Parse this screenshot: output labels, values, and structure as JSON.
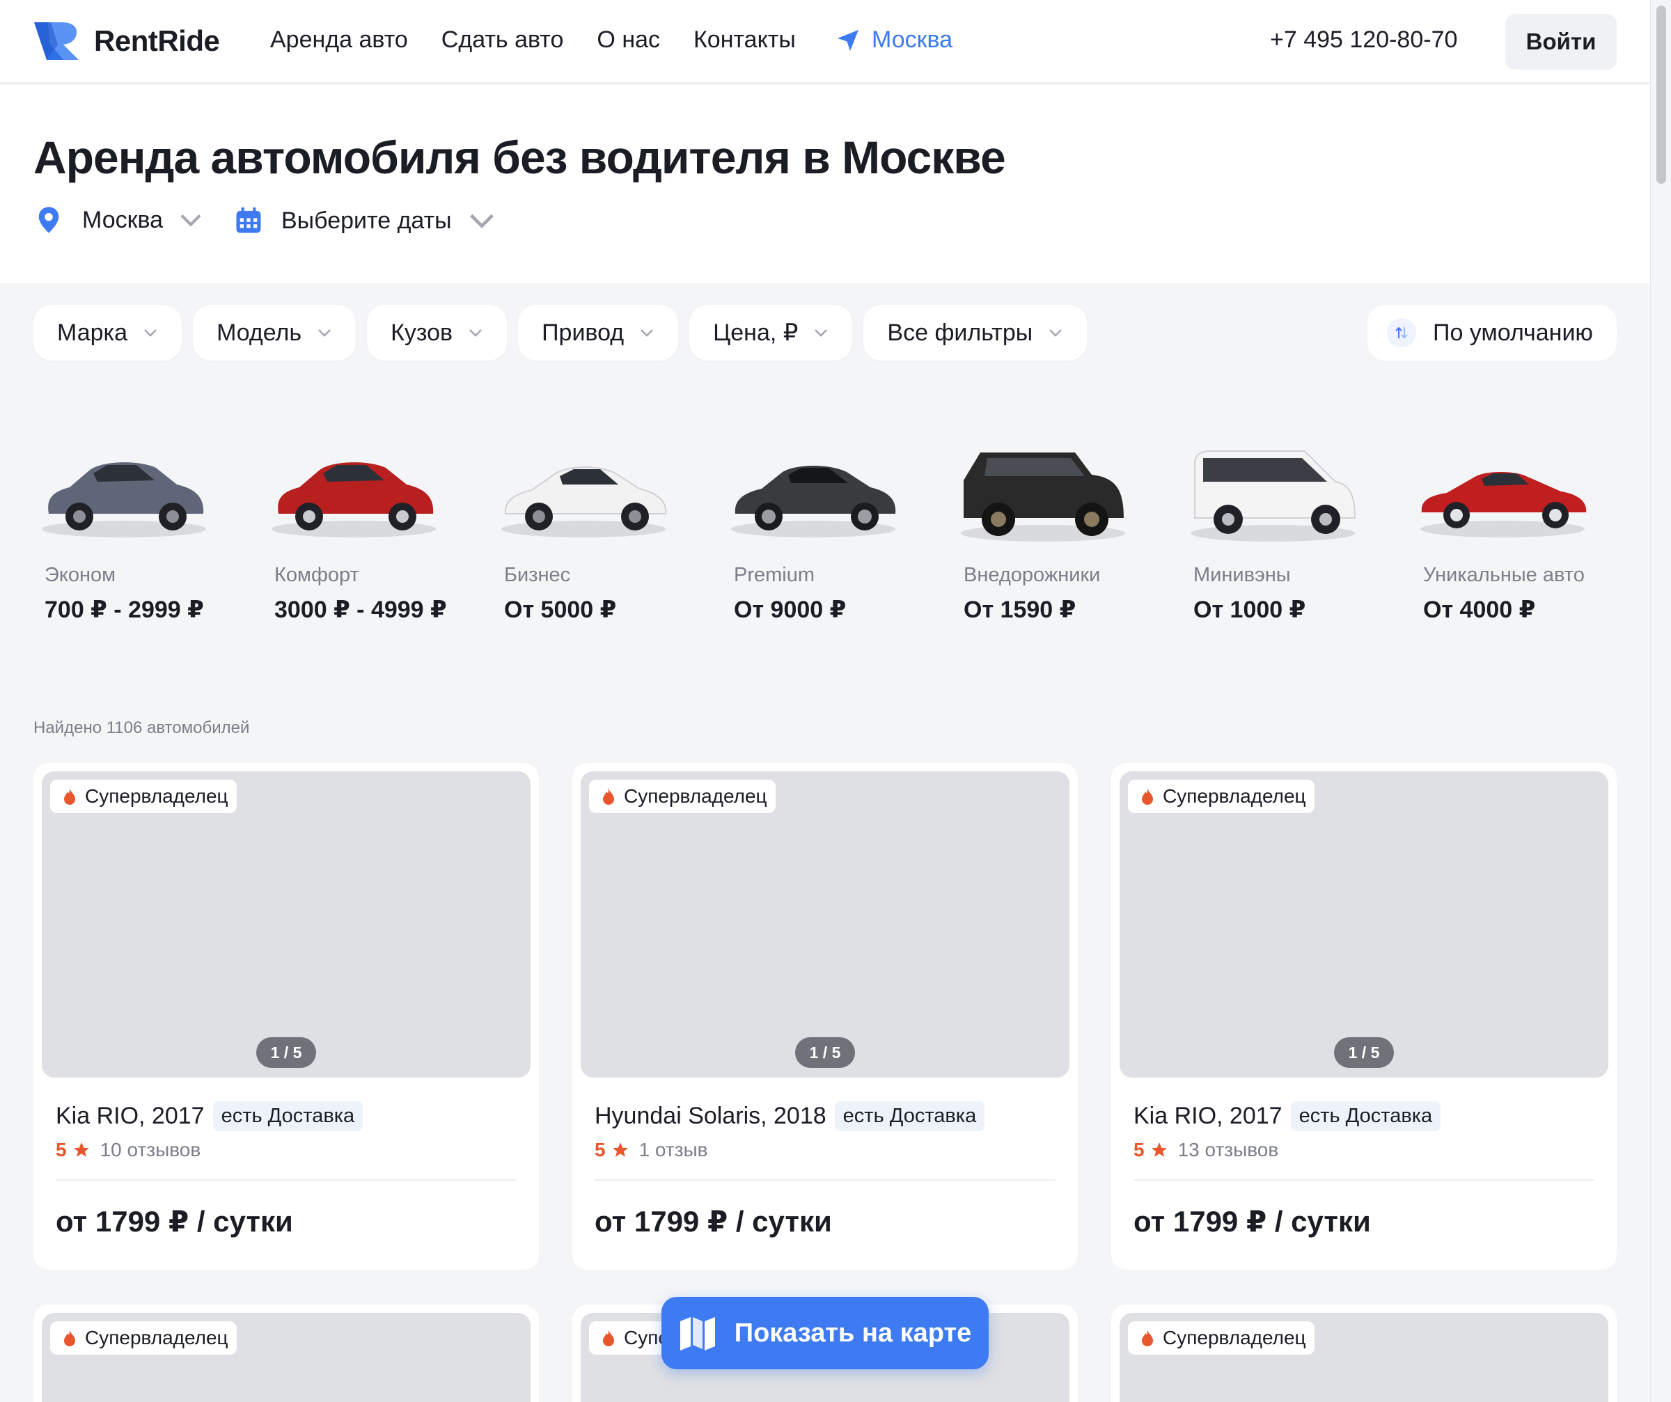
{
  "header": {
    "brand": "RentRide",
    "nav": [
      "Аренда авто",
      "Сдать авто",
      "О нас",
      "Контакты"
    ],
    "city": "Москва",
    "phone": "+7 495 120-80-70",
    "login": "Войти"
  },
  "hero": {
    "title": "Аренда автомобиля без водителя в Москве",
    "location": "Москва",
    "dates": "Выберите даты"
  },
  "filters": [
    "Марка",
    "Модель",
    "Кузов",
    "Привод",
    "Цена, ₽",
    "Все фильтры"
  ],
  "sort": "По умолчанию",
  "categories": [
    {
      "label": "Эконом",
      "price": "700 ₽ - 2999 ₽",
      "color": "#5f6677"
    },
    {
      "label": "Комфорт",
      "price": "3000 ₽ - 4999 ₽",
      "color": "#b8201f"
    },
    {
      "label": "Бизнес",
      "price": "От 5000 ₽",
      "color": "#f2f2f2"
    },
    {
      "label": "Premium",
      "price": "От 9000 ₽",
      "color": "#3a3b3e"
    },
    {
      "label": "Внедорожники",
      "price": "От 1590 ₽",
      "color": "#2a2a2a"
    },
    {
      "label": "Минивэны",
      "price": "От 1000 ₽",
      "color": "#f4f4f4"
    },
    {
      "label": "Уникальные авто",
      "price": "От 4000 ₽",
      "color": "#c11f1f"
    }
  ],
  "found": "Найдено 1106 автомобилей",
  "cards": [
    {
      "badge": "Супервладелец",
      "pager": "1 / 5",
      "name": "Kia RIO, 2017",
      "delivery": "есть Доставка",
      "rating": "5",
      "reviews": "10 отзывов",
      "price": "от 1799 ₽ / сутки"
    },
    {
      "badge": "Супервладелец",
      "pager": "1 / 5",
      "name": "Hyundai Solaris, 2018",
      "delivery": "есть Доставка",
      "rating": "5",
      "reviews": "1 отзыв",
      "price": "от 1799 ₽ / сутки"
    },
    {
      "badge": "Супервладелец",
      "pager": "1 / 5",
      "name": "Kia RIO, 2017",
      "delivery": "есть Доставка",
      "rating": "5",
      "reviews": "13 отзывов",
      "price": "от 1799 ₽ / сутки"
    }
  ],
  "cards_row2": [
    {
      "badge": "Супервладелец"
    },
    {
      "badge": "Супервладелец"
    },
    {
      "badge": "Супервладелец"
    }
  ],
  "map_button": "Показать на карте",
  "colors": {
    "accent": "#3e7bf2",
    "rating": "#e8562e"
  }
}
